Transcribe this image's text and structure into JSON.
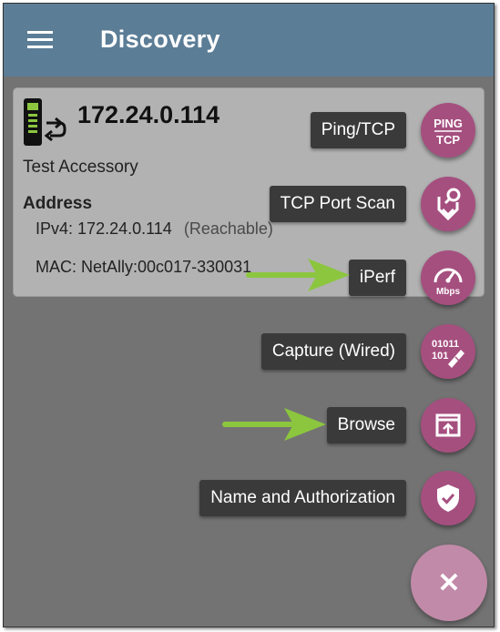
{
  "app": {
    "title": "Discovery"
  },
  "device": {
    "ip": "172.24.0.114",
    "name": "Test Accessory",
    "address_label": "Address",
    "ipv4_label": "IPv4:",
    "ipv4_value": "172.24.0.114",
    "ipv4_status": "(Reachable)",
    "mac_label": "MAC:",
    "mac_value": "NetAlly:00c017-330031"
  },
  "actions": [
    {
      "label": "Ping/TCP",
      "icon": "ping-tcp-icon",
      "icon_text": [
        "PING",
        "TCP"
      ]
    },
    {
      "label": "TCP Port Scan",
      "icon": "port-scan-icon"
    },
    {
      "label": "iPerf",
      "icon": "iperf-gauge-icon",
      "icon_text": [
        "Mbps"
      ]
    },
    {
      "label": "Capture (Wired)",
      "icon": "capture-binary-icon",
      "icon_text": [
        "01011",
        "101"
      ]
    },
    {
      "label": "Browse",
      "icon": "browse-icon"
    },
    {
      "label": "Name and Authorization",
      "icon": "shield-check-icon"
    }
  ],
  "close_button": {
    "glyph": "✕",
    "color": "#c18aa8"
  },
  "colors": {
    "appbar": "#5c7d96",
    "fab": "#a54f7f",
    "overlay": "#737373",
    "arrow": "#8cc63f"
  }
}
